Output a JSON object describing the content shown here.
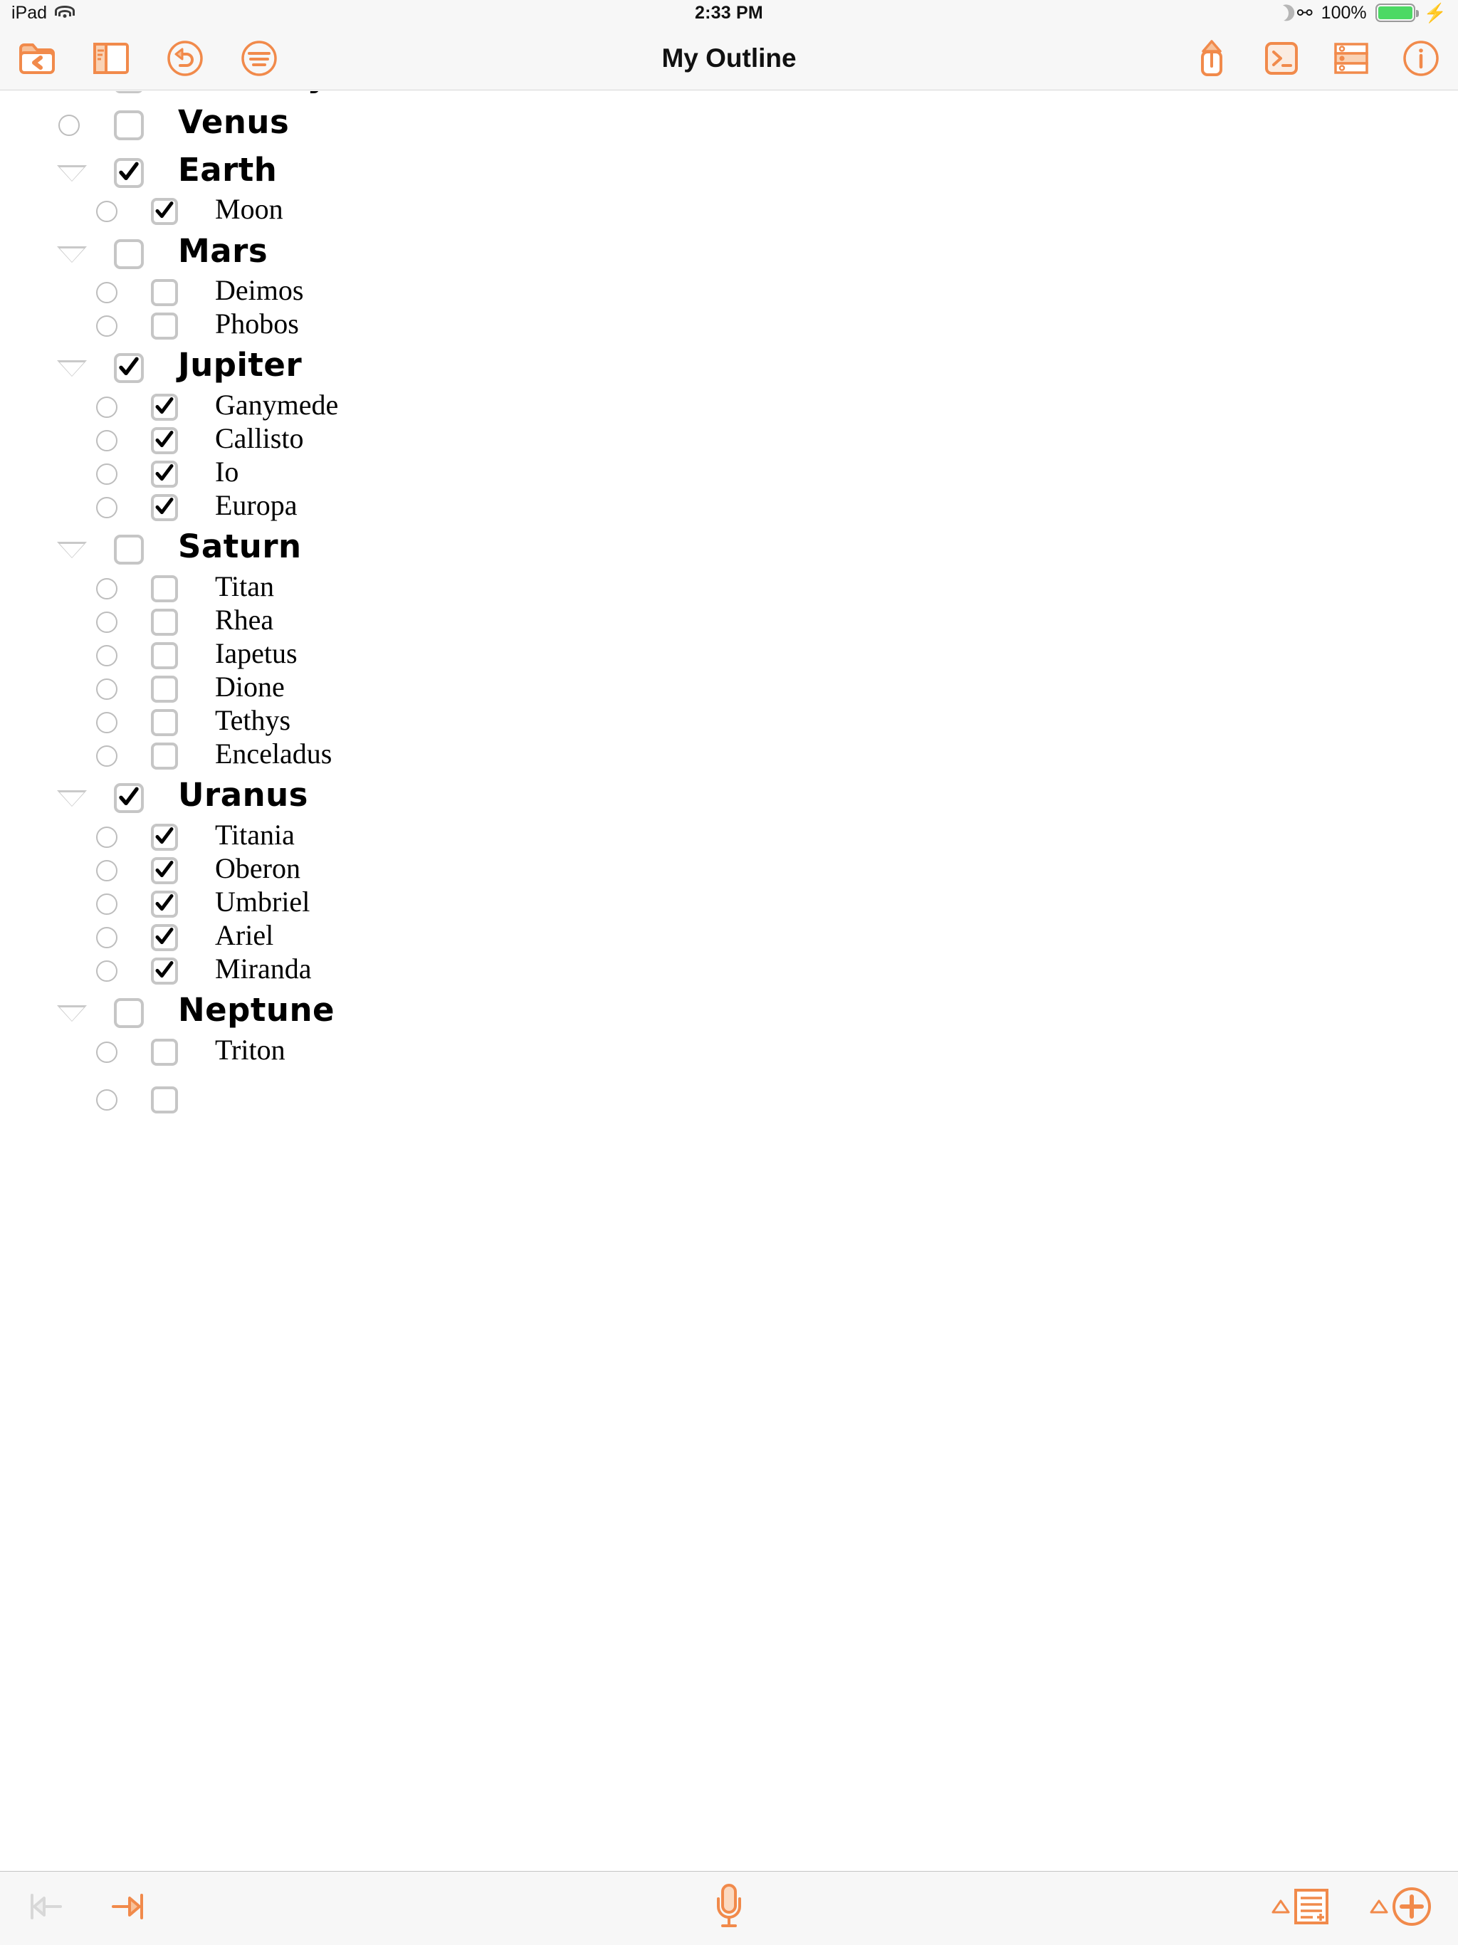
{
  "status_bar": {
    "device_label": "iPad",
    "wifi_icon": "wifi-icon",
    "time": "2:33 PM",
    "dnd_icon": "moon-icon",
    "bluetooth_icon": "bluetooth-icon",
    "battery_percent": "100%",
    "battery_icon": "battery-icon",
    "charging_icon": "lightning-bolt-icon"
  },
  "navbar": {
    "title": "My Outline",
    "left_buttons": [
      {
        "name": "back-to-documents-button",
        "icon": "folder-back-icon"
      },
      {
        "name": "sidebar-toggle-button",
        "icon": "sidebar-icon"
      },
      {
        "name": "undo-button",
        "icon": "undo-circle-icon"
      },
      {
        "name": "outline-style-button",
        "icon": "text-lines-circle-icon"
      }
    ],
    "right_buttons": [
      {
        "name": "share-button",
        "icon": "share-up-arrow-icon"
      },
      {
        "name": "script-console-button",
        "icon": "terminal-prompt-icon"
      },
      {
        "name": "row-select-button",
        "icon": "row-list-icon"
      },
      {
        "name": "info-button",
        "icon": "info-circle-icon"
      }
    ]
  },
  "outline": {
    "accent_color": "#f18a4b",
    "checkbox_border_color": "#c6c6c6",
    "handle_color": "#bdbdbd",
    "rows": [
      {
        "label": "Mercury",
        "level": 0,
        "checked": true,
        "disclosure": "none",
        "handle": true
      },
      {
        "label": "Venus",
        "level": 0,
        "checked": false,
        "disclosure": "none",
        "handle": true
      },
      {
        "label": "Earth",
        "level": 0,
        "checked": true,
        "disclosure": "expanded",
        "handle": false
      },
      {
        "label": "Moon",
        "level": 1,
        "checked": true,
        "disclosure": "none",
        "handle": true
      },
      {
        "label": "Mars",
        "level": 0,
        "checked": false,
        "disclosure": "expanded",
        "handle": false
      },
      {
        "label": "Deimos",
        "level": 1,
        "checked": false,
        "disclosure": "none",
        "handle": true
      },
      {
        "label": "Phobos",
        "level": 1,
        "checked": false,
        "disclosure": "none",
        "handle": true
      },
      {
        "label": "Jupiter",
        "level": 0,
        "checked": true,
        "disclosure": "expanded",
        "handle": false
      },
      {
        "label": "Ganymede",
        "level": 1,
        "checked": true,
        "disclosure": "none",
        "handle": true
      },
      {
        "label": "Callisto",
        "level": 1,
        "checked": true,
        "disclosure": "none",
        "handle": true
      },
      {
        "label": "Io",
        "level": 1,
        "checked": true,
        "disclosure": "none",
        "handle": true
      },
      {
        "label": "Europa",
        "level": 1,
        "checked": true,
        "disclosure": "none",
        "handle": true
      },
      {
        "label": "Saturn",
        "level": 0,
        "checked": false,
        "disclosure": "expanded",
        "handle": false
      },
      {
        "label": "Titan",
        "level": 1,
        "checked": false,
        "disclosure": "none",
        "handle": true
      },
      {
        "label": "Rhea",
        "level": 1,
        "checked": false,
        "disclosure": "none",
        "handle": true
      },
      {
        "label": "Iapetus",
        "level": 1,
        "checked": false,
        "disclosure": "none",
        "handle": true
      },
      {
        "label": "Dione",
        "level": 1,
        "checked": false,
        "disclosure": "none",
        "handle": true
      },
      {
        "label": "Tethys",
        "level": 1,
        "checked": false,
        "disclosure": "none",
        "handle": true
      },
      {
        "label": "Enceladus",
        "level": 1,
        "checked": false,
        "disclosure": "none",
        "handle": true
      },
      {
        "label": "Uranus",
        "level": 0,
        "checked": true,
        "disclosure": "expanded",
        "handle": false
      },
      {
        "label": "Titania",
        "level": 1,
        "checked": true,
        "disclosure": "none",
        "handle": true
      },
      {
        "label": "Oberon",
        "level": 1,
        "checked": true,
        "disclosure": "none",
        "handle": true
      },
      {
        "label": "Umbriel",
        "level": 1,
        "checked": true,
        "disclosure": "none",
        "handle": true
      },
      {
        "label": "Ariel",
        "level": 1,
        "checked": true,
        "disclosure": "none",
        "handle": true
      },
      {
        "label": "Miranda",
        "level": 1,
        "checked": true,
        "disclosure": "none",
        "handle": true
      },
      {
        "label": "Neptune",
        "level": 0,
        "checked": false,
        "disclosure": "expanded",
        "handle": false
      },
      {
        "label": "Triton",
        "level": 1,
        "checked": false,
        "disclosure": "none",
        "handle": true
      },
      {
        "label": "",
        "level": 1,
        "checked": false,
        "disclosure": "none",
        "handle": true
      }
    ]
  },
  "bottom_bar": {
    "left_buttons": [
      {
        "name": "outdent-button",
        "icon": "outdent-arrow-icon",
        "enabled": false
      },
      {
        "name": "indent-button",
        "icon": "indent-arrow-icon",
        "enabled": true
      }
    ],
    "center_button": {
      "name": "dictation-button",
      "icon": "microphone-icon"
    },
    "right_buttons": [
      {
        "name": "add-note-button",
        "icon": "note-add-line-icon"
      },
      {
        "name": "add-row-button",
        "icon": "plus-circle-icon"
      }
    ]
  }
}
